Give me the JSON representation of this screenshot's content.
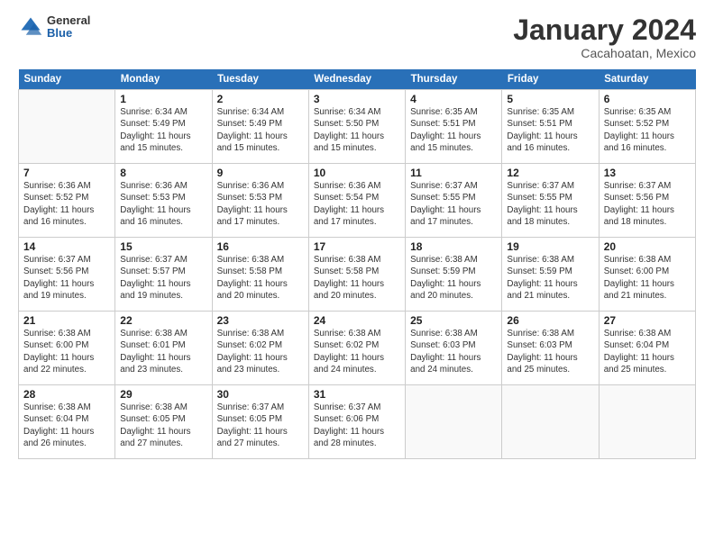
{
  "logo": {
    "general": "General",
    "blue": "Blue"
  },
  "title": "January 2024",
  "location": "Cacahoatan, Mexico",
  "days_of_week": [
    "Sunday",
    "Monday",
    "Tuesday",
    "Wednesday",
    "Thursday",
    "Friday",
    "Saturday"
  ],
  "weeks": [
    [
      {
        "day": "",
        "info": ""
      },
      {
        "day": "1",
        "info": "Sunrise: 6:34 AM\nSunset: 5:49 PM\nDaylight: 11 hours and 15 minutes."
      },
      {
        "day": "2",
        "info": "Sunrise: 6:34 AM\nSunset: 5:49 PM\nDaylight: 11 hours and 15 minutes."
      },
      {
        "day": "3",
        "info": "Sunrise: 6:34 AM\nSunset: 5:50 PM\nDaylight: 11 hours and 15 minutes."
      },
      {
        "day": "4",
        "info": "Sunrise: 6:35 AM\nSunset: 5:51 PM\nDaylight: 11 hours and 15 minutes."
      },
      {
        "day": "5",
        "info": "Sunrise: 6:35 AM\nSunset: 5:51 PM\nDaylight: 11 hours and 16 minutes."
      },
      {
        "day": "6",
        "info": "Sunrise: 6:35 AM\nSunset: 5:52 PM\nDaylight: 11 hours and 16 minutes."
      }
    ],
    [
      {
        "day": "7",
        "info": "Sunrise: 6:36 AM\nSunset: 5:52 PM\nDaylight: 11 hours and 16 minutes."
      },
      {
        "day": "8",
        "info": "Sunrise: 6:36 AM\nSunset: 5:53 PM\nDaylight: 11 hours and 16 minutes."
      },
      {
        "day": "9",
        "info": "Sunrise: 6:36 AM\nSunset: 5:53 PM\nDaylight: 11 hours and 17 minutes."
      },
      {
        "day": "10",
        "info": "Sunrise: 6:36 AM\nSunset: 5:54 PM\nDaylight: 11 hours and 17 minutes."
      },
      {
        "day": "11",
        "info": "Sunrise: 6:37 AM\nSunset: 5:55 PM\nDaylight: 11 hours and 17 minutes."
      },
      {
        "day": "12",
        "info": "Sunrise: 6:37 AM\nSunset: 5:55 PM\nDaylight: 11 hours and 18 minutes."
      },
      {
        "day": "13",
        "info": "Sunrise: 6:37 AM\nSunset: 5:56 PM\nDaylight: 11 hours and 18 minutes."
      }
    ],
    [
      {
        "day": "14",
        "info": "Sunrise: 6:37 AM\nSunset: 5:56 PM\nDaylight: 11 hours and 19 minutes."
      },
      {
        "day": "15",
        "info": "Sunrise: 6:37 AM\nSunset: 5:57 PM\nDaylight: 11 hours and 19 minutes."
      },
      {
        "day": "16",
        "info": "Sunrise: 6:38 AM\nSunset: 5:58 PM\nDaylight: 11 hours and 20 minutes."
      },
      {
        "day": "17",
        "info": "Sunrise: 6:38 AM\nSunset: 5:58 PM\nDaylight: 11 hours and 20 minutes."
      },
      {
        "day": "18",
        "info": "Sunrise: 6:38 AM\nSunset: 5:59 PM\nDaylight: 11 hours and 20 minutes."
      },
      {
        "day": "19",
        "info": "Sunrise: 6:38 AM\nSunset: 5:59 PM\nDaylight: 11 hours and 21 minutes."
      },
      {
        "day": "20",
        "info": "Sunrise: 6:38 AM\nSunset: 6:00 PM\nDaylight: 11 hours and 21 minutes."
      }
    ],
    [
      {
        "day": "21",
        "info": "Sunrise: 6:38 AM\nSunset: 6:00 PM\nDaylight: 11 hours and 22 minutes."
      },
      {
        "day": "22",
        "info": "Sunrise: 6:38 AM\nSunset: 6:01 PM\nDaylight: 11 hours and 23 minutes."
      },
      {
        "day": "23",
        "info": "Sunrise: 6:38 AM\nSunset: 6:02 PM\nDaylight: 11 hours and 23 minutes."
      },
      {
        "day": "24",
        "info": "Sunrise: 6:38 AM\nSunset: 6:02 PM\nDaylight: 11 hours and 24 minutes."
      },
      {
        "day": "25",
        "info": "Sunrise: 6:38 AM\nSunset: 6:03 PM\nDaylight: 11 hours and 24 minutes."
      },
      {
        "day": "26",
        "info": "Sunrise: 6:38 AM\nSunset: 6:03 PM\nDaylight: 11 hours and 25 minutes."
      },
      {
        "day": "27",
        "info": "Sunrise: 6:38 AM\nSunset: 6:04 PM\nDaylight: 11 hours and 25 minutes."
      }
    ],
    [
      {
        "day": "28",
        "info": "Sunrise: 6:38 AM\nSunset: 6:04 PM\nDaylight: 11 hours and 26 minutes."
      },
      {
        "day": "29",
        "info": "Sunrise: 6:38 AM\nSunset: 6:05 PM\nDaylight: 11 hours and 27 minutes."
      },
      {
        "day": "30",
        "info": "Sunrise: 6:37 AM\nSunset: 6:05 PM\nDaylight: 11 hours and 27 minutes."
      },
      {
        "day": "31",
        "info": "Sunrise: 6:37 AM\nSunset: 6:06 PM\nDaylight: 11 hours and 28 minutes."
      },
      {
        "day": "",
        "info": ""
      },
      {
        "day": "",
        "info": ""
      },
      {
        "day": "",
        "info": ""
      }
    ]
  ]
}
